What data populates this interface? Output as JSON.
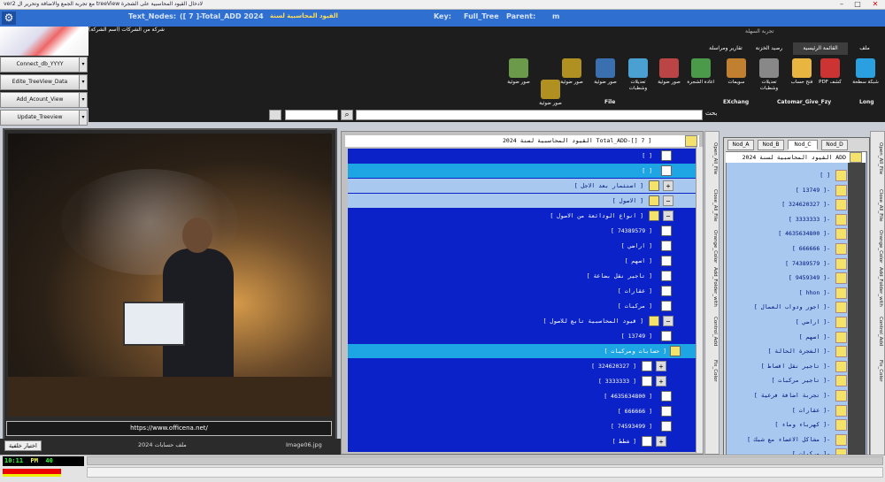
{
  "window": {
    "title": "ver2 مع تجربة الجمع والاضافة وتحرير ال treeView لادخال القيود المحاسبية على الشجرة"
  },
  "header": {
    "nodes_label": "Text_Nodes:",
    "nodes_value": "([ 7 ]-Total_ADD 2024",
    "nodes_sub": "القيود المحاسبية لسنة",
    "key_label": "Key:",
    "key_value": "Full_Tree",
    "parent_label": "Parent:",
    "parent_value": "m"
  },
  "company_name": "شركة من الشركات (اسم الشركة)",
  "left_buttons": [
    "Connect_db_YYYY",
    "Edite_TreeView_Data",
    "Add_Acount_View",
    "Update_Treeview"
  ],
  "ribbon": {
    "tabs": [
      "ملف",
      "القائمة الرئيسية",
      "رصيد الخزنة",
      "تقارير ومراسلة"
    ],
    "group_title": "تجربة السهلة",
    "buttons": [
      {
        "label": "شبكة سطحة",
        "color": "#2aa0e0"
      },
      {
        "label": "PDF كشف",
        "color": "#cc3333"
      },
      {
        "label": "فتح حساب",
        "color": "#e8b640"
      },
      {
        "label": "تعديلات وشطبات",
        "color": "#888888"
      },
      {
        "label": "سويمات",
        "color": "#c08030"
      },
      {
        "label": "اعادة الشجرة",
        "color": "#4a9a4a"
      },
      {
        "label": "صور ضوئية",
        "color": "#bb4444"
      },
      {
        "label": "تعديلات وشطبات",
        "color": "#4aa0d0"
      },
      {
        "label": "صور ضوئية",
        "color": "#3a6fb0"
      },
      {
        "label": "صور ضوئية",
        "color": "#b09020"
      },
      {
        "label": "صور ضوئية",
        "color": "#b09020"
      },
      {
        "label": "صور ضوئية",
        "color": "#6a9a4a"
      }
    ],
    "group_labels": [
      "Long",
      "Catomar_Give_Fzy",
      "EXchang",
      "File"
    ]
  },
  "search": {
    "label": "بحث"
  },
  "image_panel": {
    "url": "https://www.officena.net/",
    "button": "اختيار خلفية",
    "caption": "ملف حسابات 2024",
    "filename": "Image06.jpg"
  },
  "tree": {
    "header": "القيود المحاسبية لسنة 2024 Total_ADD-[] 7 ]",
    "rows": [
      {
        "text": "[ ]",
        "style": "dark",
        "depth": 1,
        "pm": ""
      },
      {
        "text": "[ ]",
        "style": "sel",
        "depth": 1,
        "pm": ""
      },
      {
        "text": "[ استثمار بعد الاجل ]",
        "style": "light",
        "depth": 0,
        "pm": "+"
      },
      {
        "text": "[ الاصول ]",
        "style": "light",
        "depth": 0,
        "pm": "−"
      },
      {
        "text": "[ انواع الودائعة من الاصول ]",
        "style": "dark",
        "depth": -1,
        "pm": "−"
      },
      {
        "text": "[ 74389579 ]",
        "style": "dark",
        "depth": 1,
        "pm": ""
      },
      {
        "text": "[ اراضي ]",
        "style": "dark",
        "depth": 1,
        "pm": ""
      },
      {
        "text": "[ اسهم ]",
        "style": "dark",
        "depth": 1,
        "pm": ""
      },
      {
        "text": "[ تاجير نقل بضاعة ]",
        "style": "dark",
        "depth": 1,
        "pm": ""
      },
      {
        "text": "[ عقارات ]",
        "style": "dark",
        "depth": 1,
        "pm": ""
      },
      {
        "text": "[ مركبات ]",
        "style": "dark",
        "depth": 1,
        "pm": ""
      },
      {
        "text": "[ قيود المحاسبية تابع للاصول ]",
        "style": "dark",
        "depth": -1,
        "pm": "−"
      },
      {
        "text": "[ 13749 ]",
        "style": "dark",
        "depth": 1,
        "pm": ""
      },
      {
        "text": "[ حسابات ومركبات ]",
        "style": "sel",
        "depth": 0,
        "pm": ""
      },
      {
        "text": "[ 324620327 ]",
        "style": "dark",
        "depth": 1,
        "pm": "+"
      },
      {
        "text": "[ 3333333 ]",
        "style": "dark",
        "depth": 1,
        "pm": "+"
      },
      {
        "text": "[ 4635634800 ]",
        "style": "dark",
        "depth": 1,
        "pm": ""
      },
      {
        "text": "[ 666666 ]",
        "style": "dark",
        "depth": 1,
        "pm": ""
      },
      {
        "text": "[ 74593499 ]",
        "style": "dark",
        "depth": 1,
        "pm": ""
      },
      {
        "text": "[ شطط ]",
        "style": "dark",
        "depth": 1,
        "pm": "+"
      }
    ]
  },
  "left_vtabs": [
    "Open_All_File",
    "Close_All_File",
    "Orange_Color",
    "Add_Folder_with",
    "Control_Add",
    "Fix_Color"
  ],
  "node_tabs": [
    "Nod_A",
    "Nod_B",
    "Nod_C",
    "Nod_D"
  ],
  "right_tree": {
    "header": "القيود المحاسبية لسنة 2024 ADD",
    "rows": [
      "[ ]",
      "[ 13749 ]-",
      "[ 324620327 ]-",
      "[ 3333333 ]-",
      "[ 4635634800 ]-",
      "[ 666666 ]-",
      "[ 74389579 ]-",
      "[ 9459349 ]-",
      "[ hhon ]-",
      "[ اجور ودواب العمال ]-",
      "[ اراضي ]-",
      "[ اسهم ]-",
      "[ الشجرة الحالة ]-",
      "[ تاجير نقل اقساط ]-",
      "[ تاجير مركبات ]-",
      "[ تجربة اضافة فرعية ]-",
      "[ عقارات ]-",
      "[ كهرباء وماء ]-",
      "[ مشاكل الاعضاء مع شبك ]-",
      "[ مركبات ]-"
    ]
  },
  "right_vtabs": [
    "Open_All_File",
    "Close_All_File",
    "Orange_Color",
    "Add_Folder_with",
    "Control_Add",
    "Fix_Color"
  ],
  "status": {
    "time": "10:11",
    "ampm": "PM",
    "seconds": "40"
  }
}
